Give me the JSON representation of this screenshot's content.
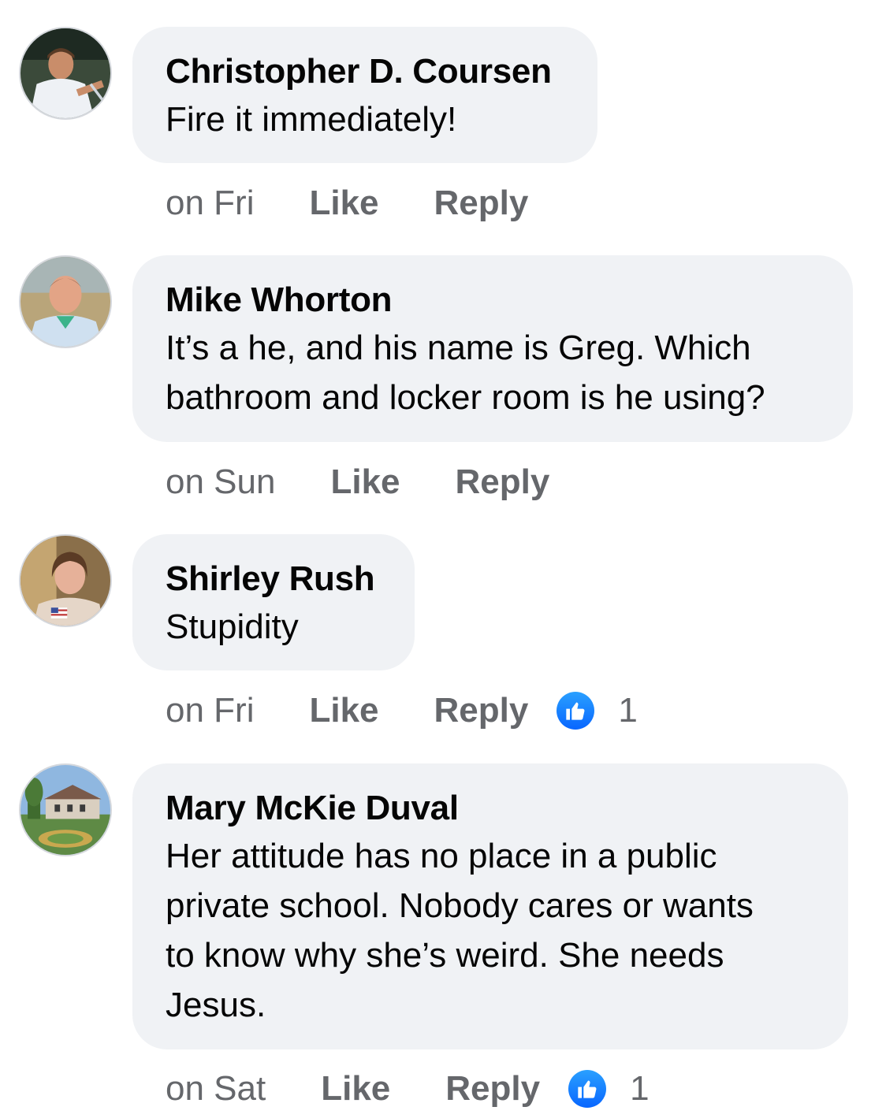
{
  "comments": [
    {
      "author": "Christopher D. Coursen",
      "text": "Fire it immediately!",
      "time": "on Fri",
      "like_label": "Like",
      "reply_label": "Reply",
      "reactions": null
    },
    {
      "author": "Mike Whorton",
      "text": "It’s a he, and his name is Greg.  Which\nbathroom and locker room is he using?",
      "time": "on Sun",
      "like_label": "Like",
      "reply_label": "Reply",
      "reactions": null
    },
    {
      "author": "Shirley Rush",
      "text": "Stupidity",
      "time": "on Fri",
      "like_label": "Like",
      "reply_label": "Reply",
      "reactions": "1"
    },
    {
      "author": "Mary McKie Duval",
      "text": "Her attitude has no place in a public\nprivate school.  Nobody cares or wants\nto know why she’s weird.  She needs\nJesus.",
      "time": "on Sat",
      "like_label": "Like",
      "reply_label": "Reply",
      "reactions": "1"
    }
  ],
  "colors": {
    "bubble": "#f0f2f5",
    "text": "#050505",
    "meta": "#65676b",
    "like_blue": "#0866ff"
  },
  "icons": {
    "reaction": "thumbs-up-icon"
  }
}
